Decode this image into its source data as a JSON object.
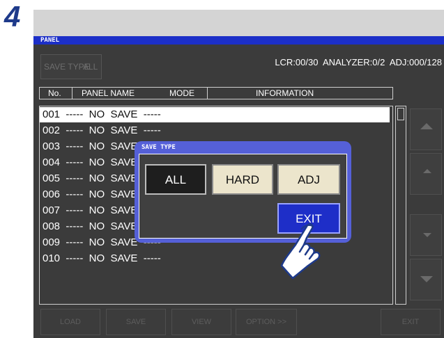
{
  "step_number": "4",
  "panel": {
    "title": "PANEL",
    "save_type_label": "SAVE TYPE",
    "save_type_value": "ALL",
    "status": "LCR:00/30  ANALYZER:0/2  ADJ:000/128",
    "columns": {
      "no": "No.",
      "panel_name": "PANEL NAME",
      "mode": "MODE",
      "information": "INFORMATION"
    },
    "rows": [
      "001  -----  NO  SAVE  -----",
      "002  -----  NO  SAVE  -----",
      "003  -----  NO  SAVE  -----",
      "004  -----  NO  SAVE  -----",
      "005  -----  NO  SAVE  -----",
      "006  -----  NO  SAVE  -----",
      "007  -----  NO  SAVE  -----",
      "008  -----  NO  SAVE  -----",
      "009  -----  NO  SAVE  -----",
      "010  -----  NO  SAVE  -----"
    ],
    "bottom_buttons": {
      "load": "LOAD",
      "save": "SAVE",
      "view": "VIEW",
      "option": "OPTION >>",
      "exit": "EXIT"
    }
  },
  "dialog": {
    "title": "SAVE TYPE",
    "all": "ALL",
    "hard": "HARD",
    "adj": "ADJ",
    "exit": "EXIT"
  },
  "colors": {
    "title_bar": "#1c2fc8",
    "dialog_frame": "#5560d8",
    "exit_button": "#1e2ec8",
    "option_button": "#ece5cc"
  }
}
